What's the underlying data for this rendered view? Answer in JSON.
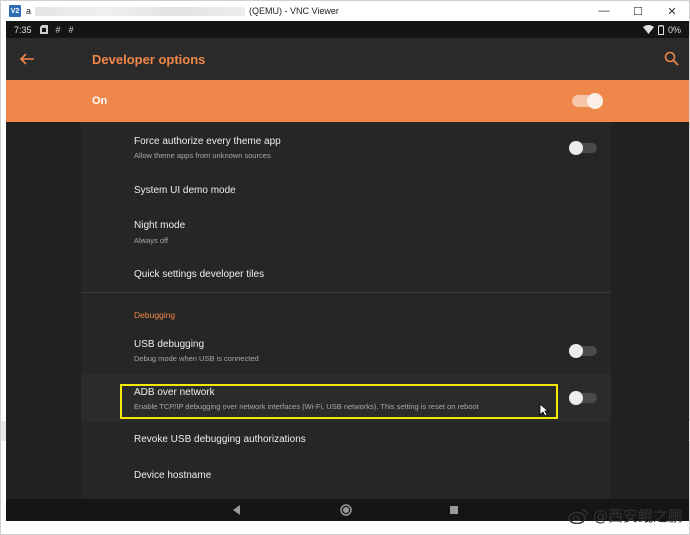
{
  "window": {
    "app_icon": "V2",
    "title_prefix": "a",
    "title_suffix": "(QEMU) - VNC Viewer",
    "controls": [
      "—",
      "☐",
      "✕"
    ]
  },
  "statusbar": {
    "time": "7:35",
    "icons": [
      "sd-card-icon",
      "hash-icon",
      "hash-icon"
    ],
    "battery": "0%"
  },
  "appbar": {
    "title": "Developer options"
  },
  "master_switch": {
    "label": "On",
    "state": true
  },
  "items": [
    {
      "title": "Force authorize every theme app",
      "subtitle": "Allow theme apps from unknown sources",
      "toggle": false
    },
    {
      "title": "System UI demo mode"
    },
    {
      "title": "Night mode",
      "subtitle": "Always off"
    },
    {
      "title": "Quick settings developer tiles"
    }
  ],
  "section": {
    "header": "Debugging"
  },
  "debug_items": [
    {
      "title": "USB debugging",
      "subtitle": "Debug mode when USB is connected",
      "toggle": false
    },
    {
      "title": "ADB over network",
      "subtitle": "Enable TCP/IP debugging over network interfaces (Wi-Fi, USB networks). This setting is reset on reboot",
      "toggle": false
    },
    {
      "title": "Revoke USB debugging authorizations"
    },
    {
      "title": "Device hostname"
    }
  ],
  "navbar": {
    "buttons": [
      "back",
      "home",
      "recents"
    ]
  },
  "watermark": {
    "text": "@西安鲲之鹏"
  },
  "colors": {
    "accent": "#f0874a",
    "highlight": "#f3e800",
    "background": "#212121"
  }
}
